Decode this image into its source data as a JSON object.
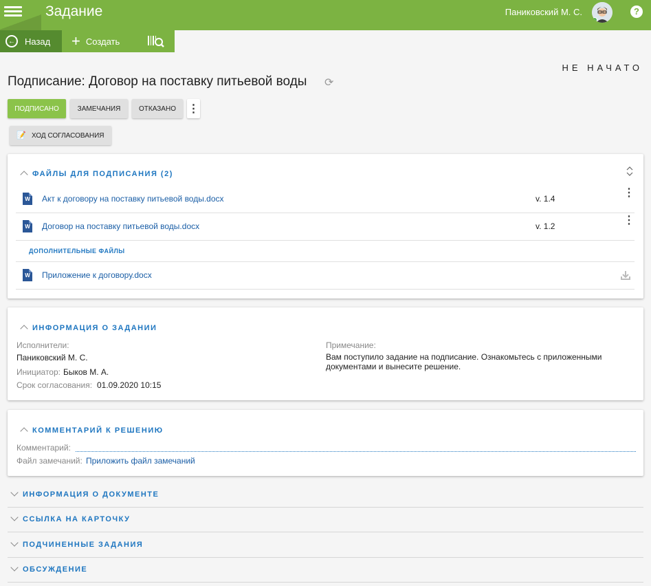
{
  "header": {
    "title": "Задание",
    "user": "Паниковский М. С.",
    "help": "?"
  },
  "toolbar": {
    "back": "Назад",
    "create": "Создать"
  },
  "status": "НЕ НАЧАТО",
  "page_title": "Подписание: Договор на поставку питьевой воды",
  "actions": {
    "signed": "ПОДПИСАНО",
    "notes": "ЗАМЕЧАНИЯ",
    "refused": "ОТКАЗАНО",
    "route": "ХОД СОГЛАСОВАНИЯ"
  },
  "files_section": {
    "title": "ФАЙЛЫ ДЛЯ ПОДПИСАНИЯ (2)",
    "files": [
      {
        "name": "Акт к договору на поставку питьевой воды.docx",
        "version": "v. 1.4"
      },
      {
        "name": "Договор на поставку питьевой воды.docx",
        "version": "v. 1.2"
      }
    ],
    "additional_title": "ДОПОЛНИТЕЛЬНЫЕ ФАЙЛЫ",
    "additional": [
      {
        "name": "Приложение к договору.docx"
      }
    ]
  },
  "task_info": {
    "title": "ИНФОРМАЦИЯ О ЗАДАНИИ",
    "executors_label": "Исполнители:",
    "executors": "Паниковский М. С.",
    "initiator_label": "Инициатор:",
    "initiator": "Быков М. А.",
    "deadline_label": "Срок согласования:",
    "deadline": "01.09.2020 10:15",
    "note_label": "Примечание:",
    "note": "Вам поступило задание на подписание. Ознакомьтесь с приложенными документами и вынесите решение."
  },
  "comment_section": {
    "title": "КОММЕНТАРИЙ К РЕШЕНИЮ",
    "comment_label": "Комментарий:",
    "comment_value": "",
    "file_label": "Файл замечаний:",
    "file_link": "Приложить файл замечаний"
  },
  "collapsed_sections": [
    "ИНФОРМАЦИЯ О ДОКУМЕНТЕ",
    "ССЫЛКА НА КАРТОЧКУ",
    "ПОДЧИНЕННЫЕ ЗАДАНИЯ",
    "ОБСУЖДЕНИЕ"
  ],
  "icons": [
    "menu-icon",
    "back-icon",
    "plus-icon",
    "barcode-search-icon",
    "refresh-icon",
    "route-icon",
    "word-file-icon",
    "more-vert-icon",
    "download-icon",
    "collapse-icon",
    "help-icon"
  ],
  "colors": {
    "brand": "#7cb342",
    "brand_dark": "#558b2f",
    "accent": "#1e76c0"
  }
}
